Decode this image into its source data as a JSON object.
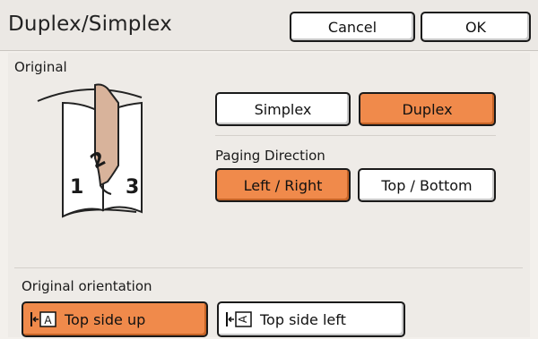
{
  "header": {
    "title": "Duplex/Simplex",
    "cancel_label": "Cancel",
    "ok_label": "OK"
  },
  "original": {
    "label": "Original",
    "illustration_pages": [
      "1",
      "2",
      "3"
    ],
    "simplex_label": "Simplex",
    "duplex_label": "Duplex",
    "selected": "Duplex"
  },
  "paging": {
    "label": "Paging Direction",
    "left_right_label": "Left / Right",
    "top_bottom_label": "Top / Bottom",
    "selected": "Left / Right"
  },
  "orientation": {
    "label": "Original orientation",
    "top_up_label": "Top side up",
    "top_up_icon_letter": "A",
    "top_left_label": "Top side left",
    "top_left_icon_letter": "A",
    "selected": "Top side up"
  },
  "colors": {
    "accent": "#f08a4b",
    "background": "#f3f0ec"
  },
  "icons": [
    "book-duplex-illustration",
    "top-side-up-icon",
    "top-side-left-icon"
  ]
}
